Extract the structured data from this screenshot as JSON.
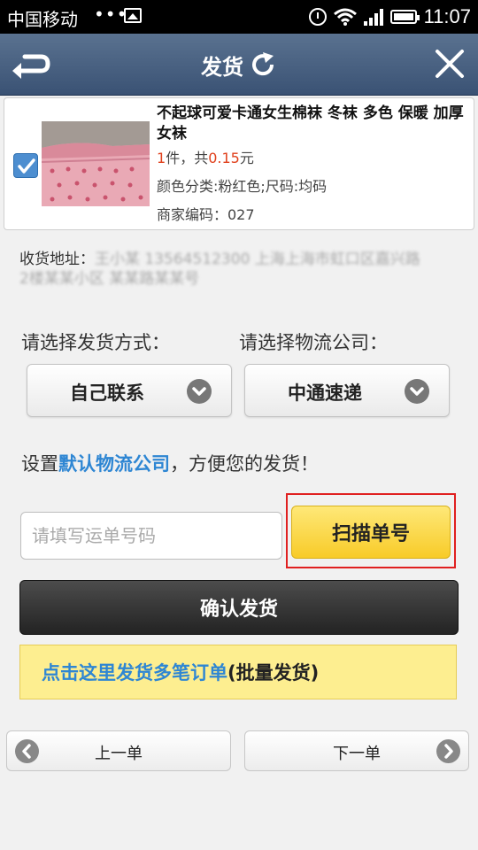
{
  "status_bar": {
    "carrier": "中国移动",
    "dots": "•••",
    "time": "11:07"
  },
  "header": {
    "title": "发货"
  },
  "product": {
    "name": "不起球可爱卡通女生棉袜 冬袜 多色 保暖 加厚女袜",
    "qty_count": "1",
    "qty_mid": "件，共",
    "qty_price": "0.15",
    "qty_unit": "元",
    "spec": "颜色分类:粉红色;尺码:均码",
    "merchant_code": "商家编码：027",
    "checked": true
  },
  "address": {
    "label": "收货地址：",
    "value_line1": "王小某 13564512300 上海上海市虹口区嘉兴路",
    "value_line2": "2楼某某小区 某某路某某号"
  },
  "shipping": {
    "method_label": "请选择发货方式：",
    "company_label": "请选择物流公司：",
    "method_value": "自己联系",
    "company_value": "中通速递"
  },
  "hint": {
    "prefix": "设置",
    "link": "默认物流公司",
    "suffix": "，方便您的发货！"
  },
  "tracking": {
    "placeholder": "请填写运单号码",
    "value": "",
    "scan_label": "扫描单号"
  },
  "confirm_label": "确认发货",
  "batch": {
    "link": "点击这里发货多笔订单",
    "suffix": "(批量发货)"
  },
  "nav": {
    "prev_label": "上一单",
    "next_label": "下一单"
  },
  "colors": {
    "header": "#3a5274",
    "accent_blue": "#2e86d3",
    "price_red": "#e0401c",
    "scan_yellow": "#f8cb28",
    "highlight_red": "#e02020"
  }
}
